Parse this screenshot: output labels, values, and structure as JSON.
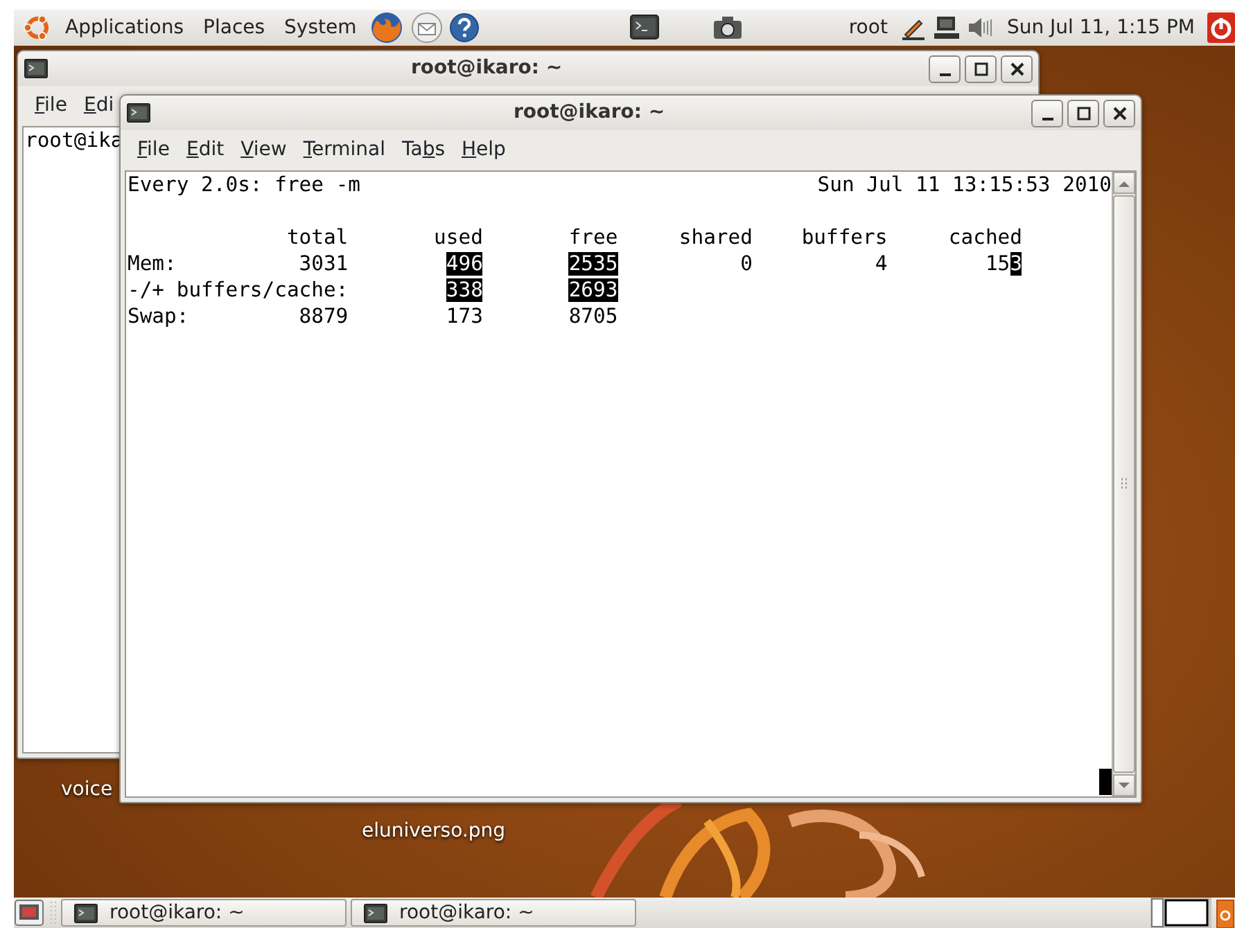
{
  "top_panel": {
    "menus": [
      "Applications",
      "Places",
      "System"
    ],
    "user": "root",
    "clock": "Sun Jul 11,  1:15 PM"
  },
  "windows": [
    {
      "title": "root@ikaro: ~",
      "menu": [
        {
          "key": "F",
          "rest": "ile"
        },
        {
          "key": "E",
          "rest": "di"
        }
      ],
      "lines": [
        "root@ika"
      ]
    },
    {
      "title": "root@ikaro: ~",
      "menu": [
        {
          "key": "F",
          "rest": "ile"
        },
        {
          "key": "E",
          "rest": "dit"
        },
        {
          "key": "V",
          "rest": "iew"
        },
        {
          "key": "T",
          "rest": "erminal"
        },
        {
          "lead": "Ta",
          "key": "b",
          "rest": "s"
        },
        {
          "key": "H",
          "rest": "elp"
        }
      ],
      "terminal": {
        "command": "Every 2.0s: free -m",
        "timestamp": "Sun Jul 11 13:15:53 2010",
        "columns": [
          "total",
          "used",
          "free",
          "shared",
          "buffers",
          "cached"
        ],
        "rows": [
          {
            "label": "Mem:",
            "cells": [
              [
                {
                  "text": "3031",
                  "changed": false
                }
              ],
              [
                {
                  "text": "496",
                  "changed": true
                }
              ],
              [
                {
                  "text": "2535",
                  "changed": true
                }
              ],
              [
                {
                  "text": "0",
                  "changed": false
                }
              ],
              [
                {
                  "text": "4",
                  "changed": false
                }
              ],
              [
                {
                  "text": "15",
                  "changed": false
                },
                {
                  "text": "3",
                  "changed": true
                }
              ]
            ]
          },
          {
            "label": "-/+ buffers/cache:",
            "cells": [
              "",
              [
                {
                  "text": "338",
                  "changed": true
                }
              ],
              [
                {
                  "text": "2693",
                  "changed": true
                }
              ]
            ]
          },
          {
            "label": "Swap:",
            "cells": [
              [
                {
                  "text": "8879",
                  "changed": false
                }
              ],
              [
                {
                  "text": "173",
                  "changed": false
                }
              ],
              [
                {
                  "text": "8705",
                  "changed": false
                }
              ]
            ]
          }
        ]
      }
    }
  ],
  "desktop_icons": [
    "voice",
    "eluniverso.png"
  ],
  "taskbar": [
    {
      "label": "root@ikaro: ~",
      "selected": false
    },
    {
      "label": "root@ikaro: ~",
      "selected": false
    }
  ]
}
